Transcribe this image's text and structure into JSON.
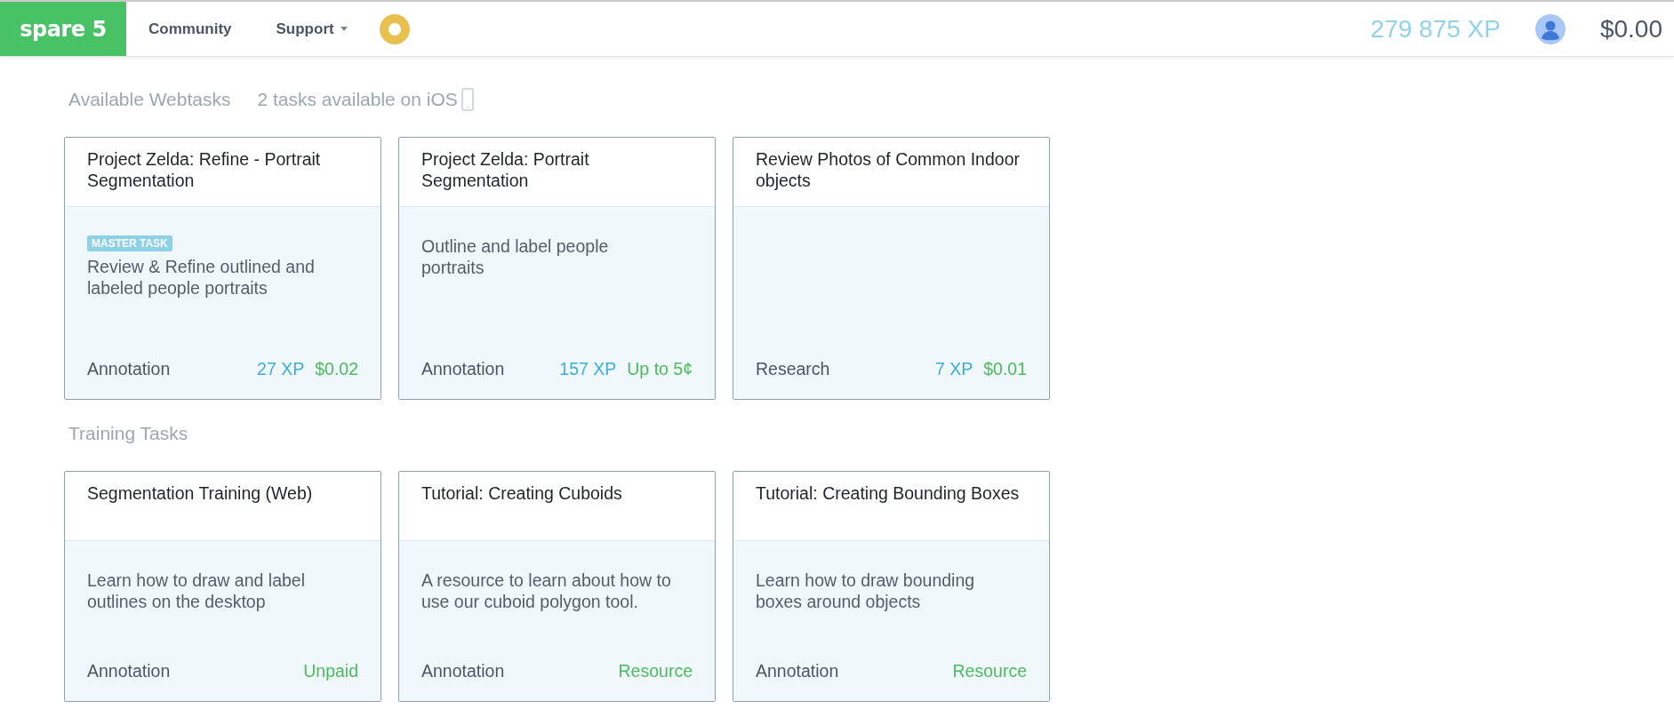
{
  "header": {
    "logo": "spare 5",
    "nav": [
      {
        "label": "Community",
        "dropdown": false
      },
      {
        "label": "Support",
        "dropdown": true
      }
    ],
    "xp": "279 875 XP",
    "balance": "$0.00"
  },
  "sections": [
    {
      "title": "Available Webtasks",
      "note": "2 tasks available on iOS",
      "cards": [
        {
          "title": "Project Zelda: Refine - Portrait Segmentation",
          "badge": "MASTER TASK",
          "description": "Review & Refine outlined and labeled people portraits",
          "category": "Annotation",
          "xp": "27 XP",
          "pay": "$0.02"
        },
        {
          "title": "Project Zelda: Portrait Segmentation",
          "description": "Outline and label people portraits",
          "category": "Annotation",
          "xp": "157 XP",
          "pay": "Up to 5¢"
        },
        {
          "title": "Review Photos of Common Indoor objects",
          "category": "Research",
          "xp": "7 XP",
          "pay": "$0.01"
        }
      ]
    },
    {
      "title": "Training Tasks",
      "cards": [
        {
          "title": "Segmentation Training (Web)",
          "description": "Learn how to draw and label outlines on the desktop",
          "category": "Annotation",
          "pay": "Unpaid"
        },
        {
          "title": "Tutorial: Creating Cuboids",
          "description": "A resource to learn about how to use our cuboid polygon tool.",
          "category": "Annotation",
          "pay": "Resource"
        },
        {
          "title": "Tutorial: Creating Bounding Boxes",
          "description": "Learn how to draw bounding boxes around objects",
          "category": "Annotation",
          "pay": "Resource"
        }
      ]
    }
  ]
}
